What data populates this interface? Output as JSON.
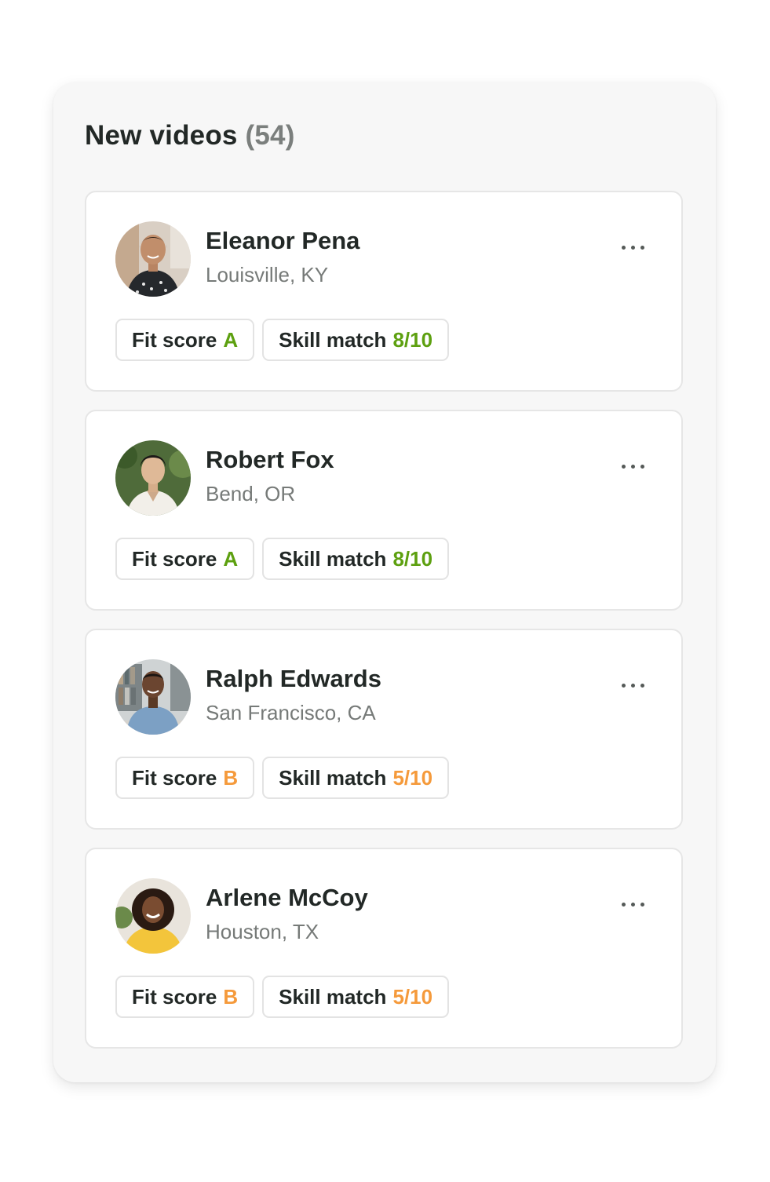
{
  "header": {
    "title": "New videos",
    "count": "(54)"
  },
  "colors": {
    "grade_good": "#5da010",
    "grade_mid": "#f59a3b"
  },
  "candidates": [
    {
      "name": "Eleanor Pena",
      "location": "Louisville, KY",
      "fit_label": "Fit score",
      "fit_value": "A",
      "skill_label": "Skill match",
      "skill_value": "8/10",
      "rating": "good"
    },
    {
      "name": "Robert Fox",
      "location": "Bend, OR",
      "fit_label": "Fit score",
      "fit_value": "A",
      "skill_label": "Skill match",
      "skill_value": "8/10",
      "rating": "good"
    },
    {
      "name": "Ralph Edwards",
      "location": "San Francisco, CA",
      "fit_label": "Fit score",
      "fit_value": "B",
      "skill_label": "Skill match",
      "skill_value": "5/10",
      "rating": "mid"
    },
    {
      "name": "Arlene McCoy",
      "location": "Houston, TX",
      "fit_label": "Fit score",
      "fit_value": "B",
      "skill_label": "Skill match",
      "skill_value": "5/10",
      "rating": "mid"
    }
  ],
  "icons": {
    "more": "more-options-icon"
  }
}
